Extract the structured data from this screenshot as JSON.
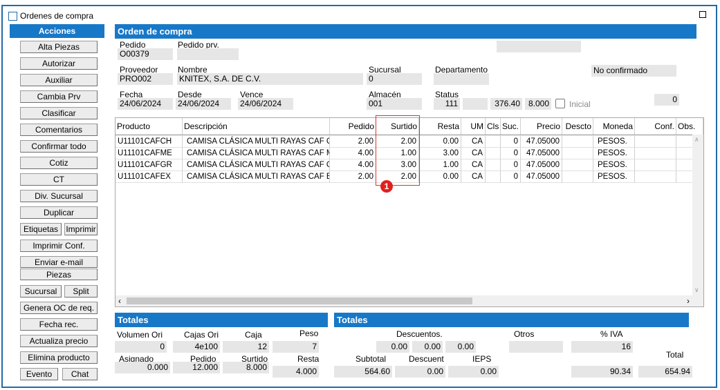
{
  "window": {
    "title": "Ordenes de compra"
  },
  "actions": {
    "header": "Acciones",
    "alta_piezas": "Alta Piezas",
    "autorizar": "Autorizar",
    "auxiliar": "Auxiliar",
    "cambia_prv": "Cambia Prv",
    "clasificar": "Clasificar",
    "comentarios": "Comentarios",
    "confirmar_todo": "Confirmar todo",
    "cotiz": "Cotiz",
    "ct": "CT",
    "div_sucursal": "Div. Sucursal",
    "duplicar": "Duplicar",
    "etiquetas": "Etiquetas",
    "imprimir": "Imprimir",
    "imprimir_conf": "Imprimir Conf.",
    "enviar_email": "Enviar e-mail",
    "piezas": "Piezas",
    "sucursal": "Sucursal",
    "split": "Split",
    "genera_oc": "Genera OC de req.",
    "fecha_rec": "Fecha rec.",
    "actualiza_precio": "Actualiza precio",
    "elimina_producto": "Elimina producto",
    "evento": "Evento",
    "chat": "Chat"
  },
  "order": {
    "section_title": "Orden de compra",
    "pedido_label": "Pedido",
    "pedido": "O00379",
    "pedido_prv_label": "Pedido prv.",
    "pedido_prv": "",
    "top_right": "",
    "proveedor_label": "Proveedor",
    "proveedor": "PRO002",
    "nombre_label": "Nombre",
    "nombre": "KNITEX, S.A. DE C.V.",
    "sucursal_label": "Sucursal",
    "sucursal": "0",
    "departamento_label": "Departamento",
    "departamento": "",
    "confirm_status": "No confirmado",
    "fecha_label": "Fecha",
    "fecha": "24/06/2024",
    "desde_label": "Desde",
    "desde": "24/06/2024",
    "vence_label": "Vence",
    "vence": "24/06/2024",
    "almacen_label": "Almacén",
    "almacen": "001",
    "status_label": "Status",
    "status": "111",
    "status_extra": "",
    "value1": "376.40",
    "value2": "8.000",
    "inicial_label": "Inicial",
    "count": "0"
  },
  "grid": {
    "headers": {
      "producto": "Producto",
      "descripcion": "Descripción",
      "pedido": "Pedido",
      "surtido": "Surtido",
      "resta": "Resta",
      "um": "UM",
      "cls": "Cls",
      "suc": "Suc.",
      "precio": "Precio",
      "descto": "Descto",
      "moneda": "Moneda",
      "conf": "Conf.",
      "obs": "Obs."
    },
    "rows": [
      {
        "producto": "U11101CAFCH",
        "descripcion": "CAMISA CLÁSICA MULTI RAYAS CAF CH",
        "pedido": "2.00",
        "surtido": "2.00",
        "resta": "0.00",
        "um": "CA",
        "cls": "",
        "suc": "0",
        "precio": "47.05000",
        "descto": "",
        "moneda": "PESOS.",
        "conf": "",
        "obs": ""
      },
      {
        "producto": "U11101CAFME",
        "descripcion": "CAMISA CLÁSICA MULTI RAYAS CAF ME",
        "pedido": "4.00",
        "surtido": "1.00",
        "resta": "3.00",
        "um": "CA",
        "cls": "",
        "suc": "0",
        "precio": "47.05000",
        "descto": "",
        "moneda": "PESOS.",
        "conf": "",
        "obs": ""
      },
      {
        "producto": "U11101CAFGR",
        "descripcion": "CAMISA CLÁSICA MULTI RAYAS CAF GR",
        "pedido": "4.00",
        "surtido": "3.00",
        "resta": "1.00",
        "um": "CA",
        "cls": "",
        "suc": "0",
        "precio": "47.05000",
        "descto": "",
        "moneda": "PESOS.",
        "conf": "",
        "obs": ""
      },
      {
        "producto": "U11101CAFEX",
        "descripcion": "CAMISA CLÁSICA MULTI RAYAS CAF EX",
        "pedido": "2.00",
        "surtido": "2.00",
        "resta": "0.00",
        "um": "CA",
        "cls": "",
        "suc": "0",
        "precio": "47.05000",
        "descto": "",
        "moneda": "PESOS.",
        "conf": "",
        "obs": ""
      }
    ]
  },
  "callout": {
    "number": "1",
    "color": "#e02020"
  },
  "totales_left": {
    "title": "Totales",
    "volumen_ori_label": "Volumen Ori",
    "volumen_ori": "0",
    "cajas_ori_label": "Cajas Ori",
    "cajas_ori": "4e100",
    "caja_label": "Caja",
    "caja": "12",
    "peso_label": "Peso",
    "peso": "7",
    "asignado_label": "Asignado",
    "asignado": "0.000",
    "pedido_label": "Pedido",
    "pedido": "12.000",
    "surtido_label": "Surtido",
    "surtido": "8.000",
    "resta_label": "Resta",
    "resta": "4.000"
  },
  "totales_right": {
    "title": "Totales",
    "descuentos_label": "Descuentos.",
    "desc1": "0.00",
    "desc2": "0.00",
    "desc3": "0.00",
    "otros_label": "Otros",
    "otros": "",
    "iva_label": "% IVA",
    "iva": "16",
    "total_label": "Total",
    "subtotal_label": "Subtotal",
    "subtotal": "564.60",
    "descuent_label": "Descuent",
    "descuent": "0.00",
    "ieps_label": "IEPS",
    "ieps": "0.00",
    "iva_amount": "90.34",
    "total": "654.94"
  },
  "colors": {
    "accent": "#1878c8",
    "field_bg": "#e6e6e6",
    "window_border": "#1f6aa5"
  }
}
